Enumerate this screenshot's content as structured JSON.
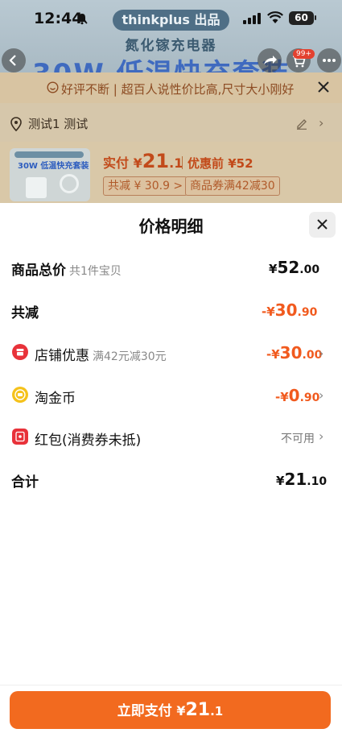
{
  "status_bar": {
    "time": "12:44",
    "battery": "60"
  },
  "banner": {
    "brand": "thinkplus 出品",
    "subtitle": "氮化镓充电器",
    "headline": "30W 低温快充套装",
    "cart_badge": "99+"
  },
  "review_banner": {
    "text": "好评不断 | 超百人说性价比高,尺寸大小刚好"
  },
  "address": {
    "text": "测试1 测试"
  },
  "product": {
    "image_tag": "",
    "image_title": "30W 低温快充套装",
    "paid_label": "实付 ¥",
    "paid_int": "21",
    "paid_dec": ".1",
    "pre_discount": "优惠前 ¥52",
    "total_discount_tag": "共减 ¥ 30.9 >",
    "coupon_tag": "商品券满42减30"
  },
  "sheet": {
    "title": "价格明细",
    "rows": {
      "goods_total": {
        "label": "商品总价",
        "sub": "共1件宝贝",
        "currency": "¥",
        "int": "52",
        "dec": ".00"
      },
      "total_off": {
        "label": "共减",
        "currency": "-¥",
        "int": "30",
        "dec": ".90"
      },
      "shop_discount": {
        "label": "店铺优惠",
        "sub": "满42元减30元",
        "currency": "-¥",
        "int": "30",
        "dec": ".00"
      },
      "taojinbi": {
        "label": "淘金币",
        "currency": "-¥",
        "int": "0",
        "dec": ".90"
      },
      "red_packet": {
        "label": "红包(消费券未抵)",
        "status": "不可用"
      },
      "total": {
        "label": "合计",
        "currency": "¥",
        "int": "21",
        "dec": ".10"
      }
    }
  },
  "pay_button": {
    "label": "立即支付",
    "currency": "¥",
    "int": "21",
    "dec": ".1"
  },
  "colors": {
    "accent": "#f26a1f",
    "discount": "#f15a1e",
    "shop_icon": "#e8323a",
    "coin_icon": "#f5c21b"
  }
}
